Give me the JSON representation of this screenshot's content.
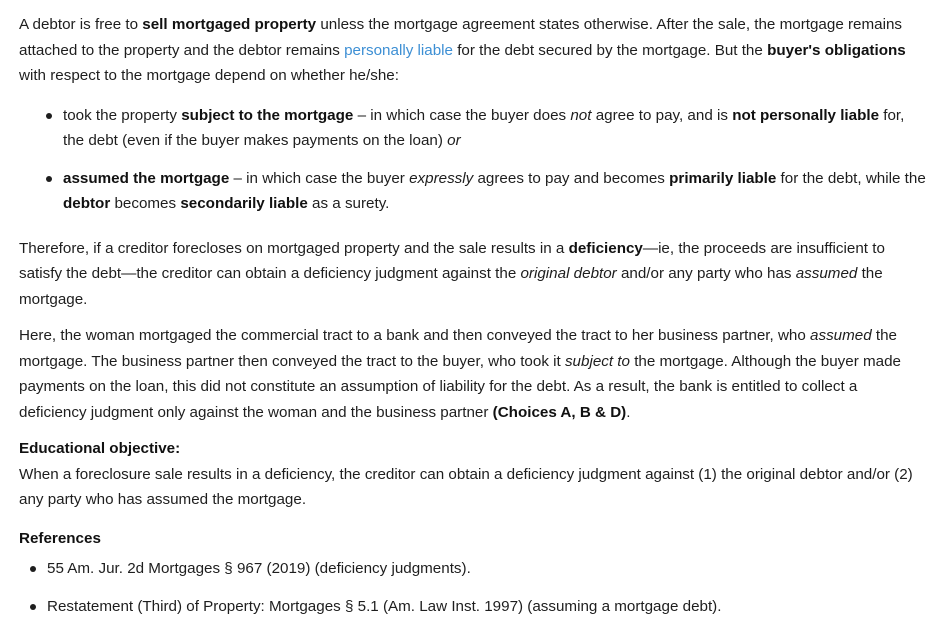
{
  "para1": {
    "s1": "A debtor is free to ",
    "b1": "sell mortgaged property",
    "s2": " unless the mortgage agreement states otherwise.  After the sale, the mortgage remains attached to the property and the debtor remains ",
    "link": "personally liable",
    "s3": " for the debt secured by the mortgage.  But the ",
    "b2": "buyer's obligations",
    "s4": " with respect to the mortgage depend on whether he/she:"
  },
  "bullet1": {
    "s1": "took the property ",
    "b1": "subject to the mortgage",
    "s2": " – in which case the buyer does ",
    "i1": "not",
    "s3": " agree to pay, and is ",
    "b2": "not personally liable",
    "s4": " for, the debt (even if the buyer makes payments on the loan) ",
    "i2": "or"
  },
  "bullet2": {
    "b1": "assumed the mortgage",
    "s1": " – in which case the buyer ",
    "i1": "expressly",
    "s2": " agrees to pay and becomes ",
    "b2": "primarily liable",
    "s3": " for the debt, while the ",
    "b3": "debtor",
    "s4": " becomes ",
    "b4": "secondarily liable",
    "s5": " as a surety."
  },
  "para2": {
    "s1": "Therefore, if a creditor forecloses on mortgaged property and the sale results in a ",
    "b1": "deficiency",
    "s2": "—ie, the proceeds are insufficient to satisfy the debt—the creditor can obtain a deficiency judgment against the ",
    "i1": "original debtor",
    "s3": " and/or any party who has ",
    "i2": "assumed",
    "s4": " the mortgage."
  },
  "para3": {
    "s1": "Here, the woman mortgaged the commercial tract to a bank and then conveyed the tract to her business partner, who ",
    "i1": "assumed",
    "s2": " the mortgage.  The business partner then conveyed the tract to the buyer, who took it ",
    "i2": "subject to",
    "s3": " the mortgage.  Although the buyer made payments on the loan, this did not constitute an assumption of liability for the debt.  As a result, the bank is entitled to collect a deficiency judgment only against the woman and the business partner ",
    "b1": "(Choices A, B & D)",
    "s4": "."
  },
  "objective": {
    "heading": "Educational objective:",
    "text": "When a foreclosure sale results in a deficiency, the creditor can obtain a deficiency judgment against (1) the original debtor and/or (2) any party who has assumed the mortgage."
  },
  "references": {
    "heading": "References",
    "items": [
      "55 Am. Jur. 2d Mortgages § 967 (2019) (deficiency judgments).",
      "Restatement (Third) of Property: Mortgages § 5.1 (Am. Law Inst. 1997) (assuming a mortgage debt)."
    ]
  }
}
